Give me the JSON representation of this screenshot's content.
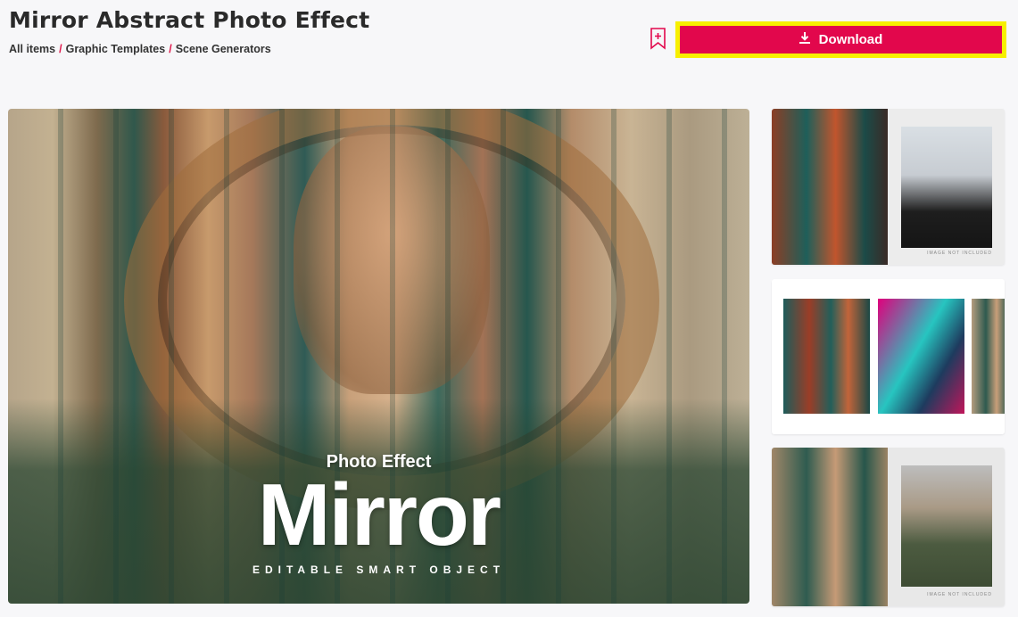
{
  "page": {
    "title": "Mirror Abstract Photo Effect",
    "breadcrumb": [
      {
        "label": "All items"
      },
      {
        "label": "Graphic Templates"
      },
      {
        "label": "Scene Generators"
      }
    ],
    "breadcrumb_separator": "/"
  },
  "actions": {
    "bookmark_icon": "bookmark-plus-icon",
    "download_label": "Download",
    "download_icon": "download-icon"
  },
  "preview": {
    "subtitle": "Photo Effect",
    "headline": "Mirror",
    "tagline": "EDITABLE SMART OBJECT"
  },
  "thumbnails": [
    {
      "note": "IMAGE NOT INCLUDED"
    },
    {},
    {
      "note": "IMAGE NOT INCLUDED"
    }
  ],
  "colors": {
    "accent": "#e2074c",
    "highlight": "#f7ef00",
    "background": "#f7f7f9"
  }
}
